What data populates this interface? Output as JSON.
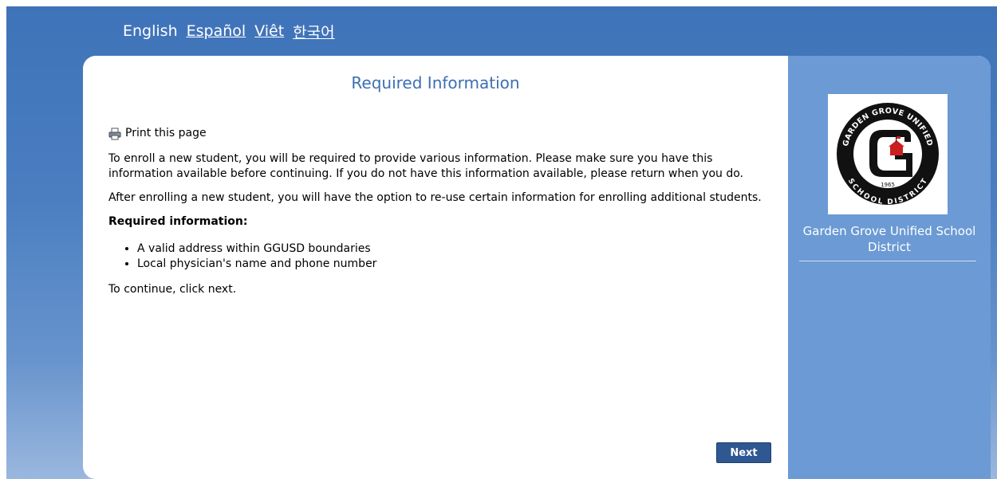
{
  "languages": [
    {
      "label": "English",
      "active": true
    },
    {
      "label": "Español",
      "active": false
    },
    {
      "label": "Viêt",
      "active": false
    },
    {
      "label": "한국어",
      "active": false
    }
  ],
  "main": {
    "title": "Required Information",
    "print_label": "Print this page",
    "paragraph1": "To enroll a new student, you will be required to provide various information. Please make sure you have this information available before continuing. If you do not have this information available, please return when you do.",
    "paragraph2": "After enrolling a new student, you will have the option to re-use certain information for enrolling additional students.",
    "required_heading": "Required information:",
    "requirements": [
      "A valid address within GGUSD boundaries",
      "Local physician's name and phone number"
    ],
    "continue_text": "To continue, click next.",
    "next_label": "Next"
  },
  "sidebar": {
    "logo_text_top": "GARDEN GROVE UNIFIED",
    "logo_text_bottom": "SCHOOL DISTRICT",
    "logo_year": "1965",
    "district_name": "Garden Grove Unified School District"
  },
  "colors": {
    "header_blue": "#4a7ec1",
    "title_blue": "#3d6eb3",
    "sidebar_blue": "#6b9ad4",
    "button_blue": "#2f5792"
  }
}
